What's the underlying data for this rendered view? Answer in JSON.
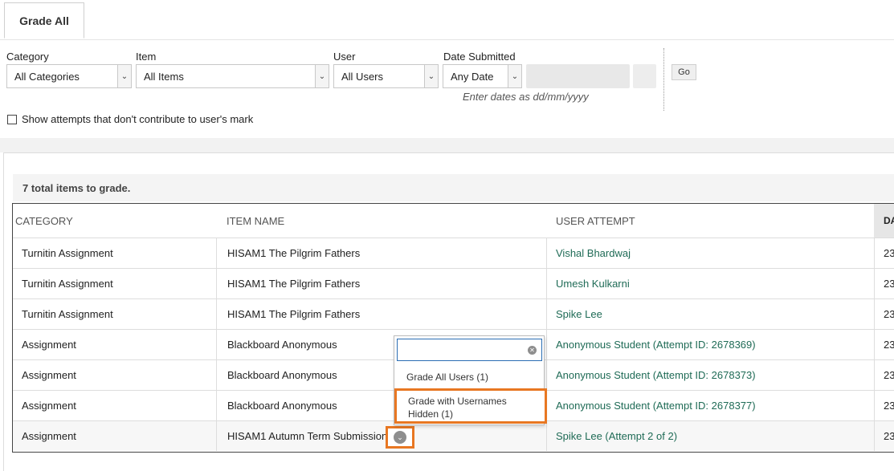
{
  "tab": {
    "label": "Grade All"
  },
  "filters": {
    "category_label": "Category",
    "category_value": "All Categories",
    "item_label": "Item",
    "item_value": "All Items",
    "user_label": "User",
    "user_value": "All Users",
    "date_label": "Date Submitted",
    "date_value": "Any Date",
    "date_hint": "Enter dates as dd/mm/yyyy",
    "go_label": "Go",
    "show_attempts_label": "Show attempts that don't contribute to user's mark",
    "show_attempts_checked": false
  },
  "summary": {
    "total_text": "7 total items to grade."
  },
  "table": {
    "headers": [
      "CATEGORY",
      "ITEM NAME",
      "USER ATTEMPT",
      "DA"
    ],
    "rows": [
      {
        "category": "Turnitin Assignment",
        "item": "HISAM1 The Pilgrim Fathers",
        "user": "Vishal Bhardwaj",
        "date": "23"
      },
      {
        "category": "Turnitin Assignment",
        "item": "HISAM1 The Pilgrim Fathers",
        "user": "Umesh Kulkarni",
        "date": "23"
      },
      {
        "category": "Turnitin Assignment",
        "item": "HISAM1 The Pilgrim Fathers",
        "user": "Spike Lee",
        "date": "23"
      },
      {
        "category": "Assignment",
        "item": "Blackboard Anonymous",
        "user": "Anonymous Student (Attempt ID: 2678369)",
        "date": "23"
      },
      {
        "category": "Assignment",
        "item": "Blackboard Anonymous",
        "user": "Anonymous Student (Attempt ID: 2678373)",
        "date": "23"
      },
      {
        "category": "Assignment",
        "item": "Blackboard Anonymous",
        "user": "Anonymous Student (Attempt ID: 2678377)",
        "date": "23"
      },
      {
        "category": "Assignment",
        "item": "HISAM1 Autumn Term Submission",
        "user": "Spike Lee (Attempt 2 of 2)",
        "date": "23"
      }
    ]
  },
  "context_menu": {
    "search_value": "",
    "items": [
      "Grade All Users (1)",
      "Grade with Usernames Hidden (1)"
    ]
  },
  "colors": {
    "link": "#1f6b56",
    "highlight": "#e87722",
    "focus": "#2a6db3"
  }
}
